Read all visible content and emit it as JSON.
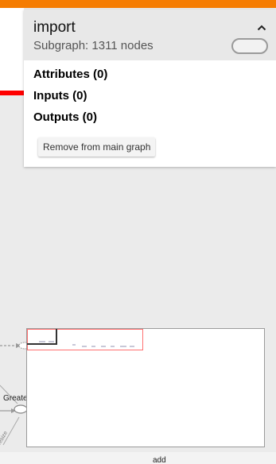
{
  "info_card": {
    "title": "import",
    "subtitle": "Subgraph: 1311 nodes",
    "collapse_icon": "chevron-up-icon",
    "sections": {
      "attributes": "Attributes (0)",
      "inputs": "Inputs (0)",
      "outputs": "Outputs (0)"
    },
    "remove_button_label": "Remove from main graph"
  },
  "graph": {
    "node_labels": {
      "greater": "Greate",
      "add": "add",
      "slanted": "resize"
    }
  },
  "colors": {
    "top_bar": "#f57c00",
    "highlight_red": "#ff0000",
    "minimap_view_border": "#ff7070"
  }
}
